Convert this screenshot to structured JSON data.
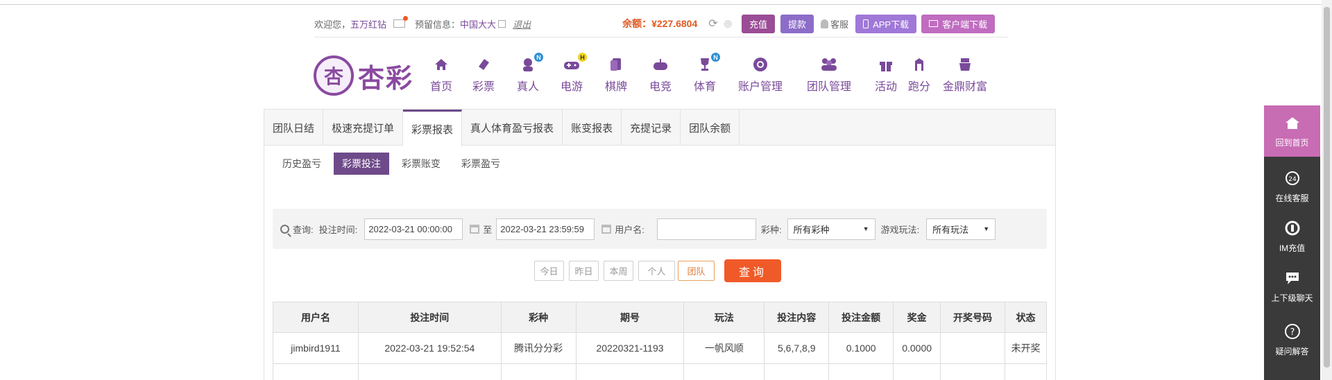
{
  "topbar": {
    "welcome": "欢迎您，",
    "username": "五万红钻",
    "reserved_label": "预留信息：",
    "reserved_value": "中国大大",
    "logout": "退出",
    "balance_label": "余额：",
    "balance_value": "¥227.6804",
    "recharge": "充值",
    "withdraw": "提款",
    "service": "客服",
    "app_download": "APP下载",
    "client_download": "客户端下载"
  },
  "logo": {
    "mark": "杏",
    "text": "杏彩"
  },
  "nav": [
    {
      "label": "首页",
      "icon": "home-icon"
    },
    {
      "label": "彩票",
      "icon": "lottery-icon"
    },
    {
      "label": "真人",
      "icon": "live-dealer-icon",
      "badge": "N"
    },
    {
      "label": "电游",
      "icon": "gamepad-icon",
      "badge": "H"
    },
    {
      "label": "棋牌",
      "icon": "cards-icon"
    },
    {
      "label": "电竞",
      "icon": "esports-icon"
    },
    {
      "label": "体育",
      "icon": "trophy-icon",
      "badge": "N"
    },
    {
      "label": "账户管理",
      "icon": "account-icon"
    },
    {
      "label": "团队管理",
      "icon": "team-icon"
    },
    {
      "label": "活动",
      "icon": "gift-icon"
    },
    {
      "label": "跑分",
      "icon": "run-icon"
    },
    {
      "label": "金鼎财富",
      "icon": "wealth-icon"
    }
  ],
  "tabs": [
    "团队日结",
    "极速充提订单",
    "彩票报表",
    "真人体育盈亏报表",
    "账变报表",
    "充提记录",
    "团队余额"
  ],
  "subtabs": [
    "历史盈亏",
    "彩票投注",
    "彩票账变",
    "彩票盈亏"
  ],
  "query": {
    "label": "查询:",
    "time_label": "投注时间:",
    "start": "2022-03-21 00:00:00",
    "to": "至",
    "end": "2022-03-21 23:59:59",
    "user_label": "用户名:",
    "user_value": "",
    "lottery_label": "彩种:",
    "lottery_value": "所有彩种",
    "play_label": "游戏玩法:",
    "play_value": "所有玩法"
  },
  "quick": {
    "today": "今日",
    "yesterday": "昨日",
    "week": "本周",
    "personal": "个人",
    "team": "团队"
  },
  "query_button": "查询",
  "table": {
    "headers": [
      "用户名",
      "投注时间",
      "彩种",
      "期号",
      "玩法",
      "投注内容",
      "投注金额",
      "奖金",
      "开奖号码",
      "状态"
    ],
    "rows": [
      [
        "jimbird1911",
        "2022-03-21 19:52:54",
        "腾讯分分彩",
        "20220321-1193",
        "一帆风顺",
        "5,6,7,8,9",
        "0.1000",
        "0.0000",
        "",
        "未开奖"
      ]
    ]
  },
  "float": [
    {
      "label": "回到首页",
      "icon": "home-icon"
    },
    {
      "label": "在线客服",
      "icon": "headset-icon"
    },
    {
      "label": "IM充值",
      "icon": "im-recharge-icon"
    },
    {
      "label": "上下级聊天",
      "icon": "chat-icon"
    },
    {
      "label": "疑问解答",
      "icon": "question-icon"
    }
  ],
  "colors": {
    "brand": "#8a4aa0",
    "balance": "#e05a22",
    "query_button": "#f05a28",
    "status_pending": "#38a838"
  }
}
